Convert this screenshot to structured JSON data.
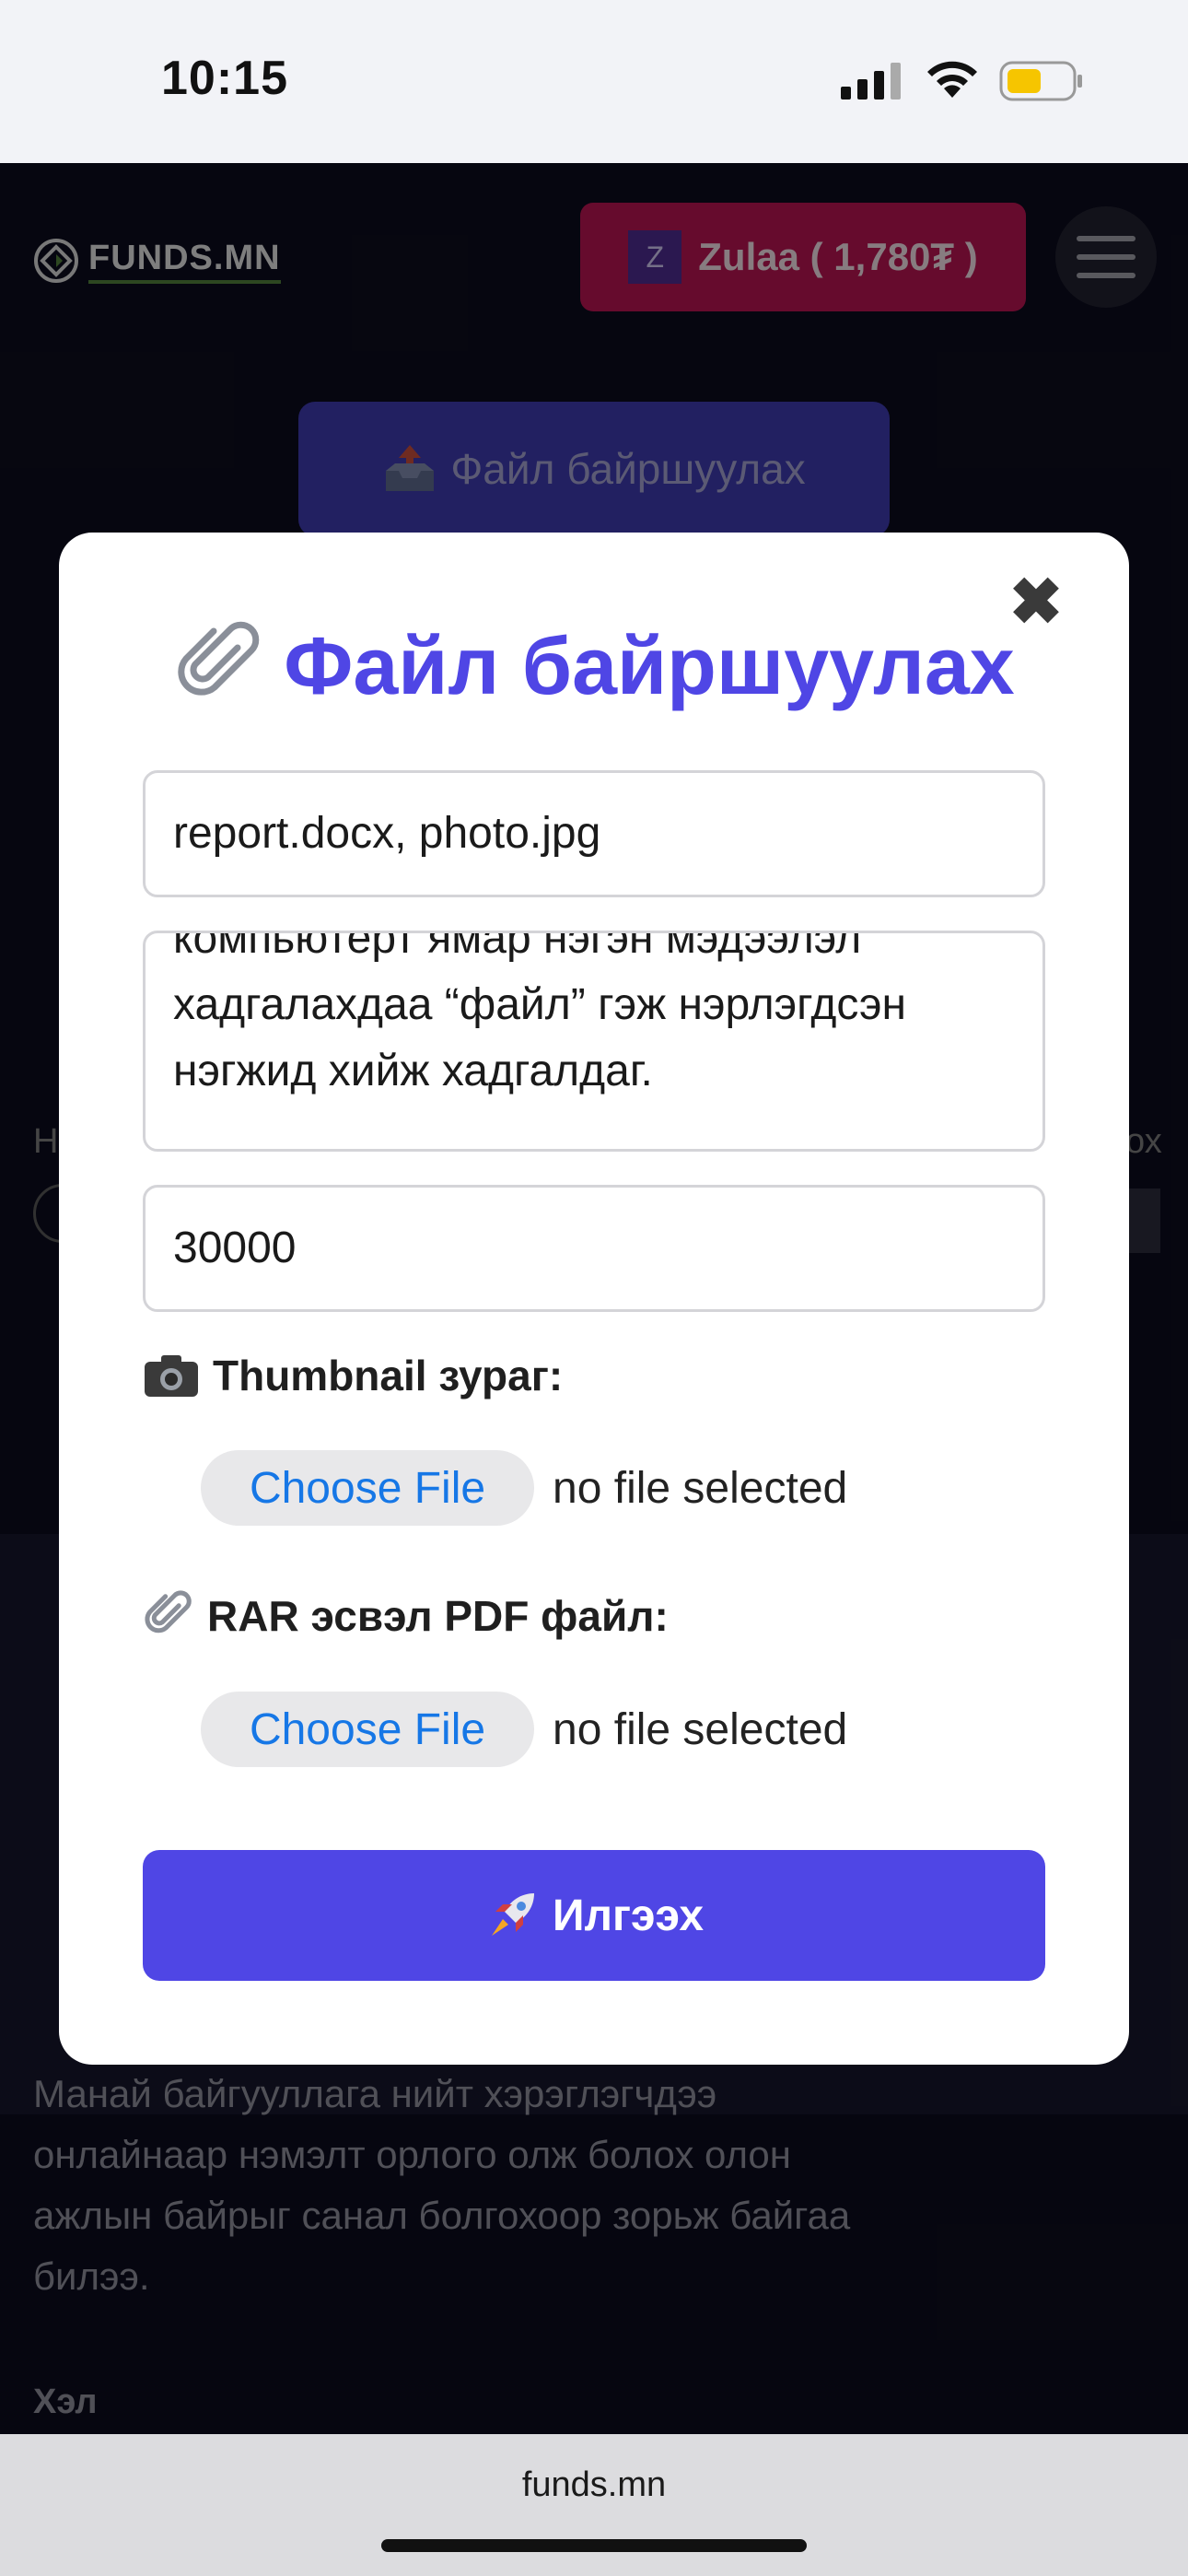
{
  "status_bar": {
    "time": "10:15"
  },
  "header": {
    "logo_text": "FUNDS.MN",
    "user_initial": "Z",
    "user_label": "Zulaa ( 1,780₮ )"
  },
  "background": {
    "upload_button_label": "Файл байршуулах",
    "left_peek": "Н",
    "right_peek": "ох",
    "about_text": "Манай байгууллага нийт хэрэглэгчдээ онлайнаар нэмэлт орлого олж болох олон ажлын байрыг санал болгохоор зорьж байгаа билээ.",
    "language_label": "Хэл"
  },
  "modal": {
    "title": "Файл байршуулах",
    "close_symbol": "✖",
    "name_field_value": "report.docx, photo.jpg",
    "description_value": "компьютерт ямар нэгэн мэдээлэл хадгалахдаа “файл” гэж нэрлэгдсэн нэгжид хийж хадгалдаг.",
    "price_field_value": "30000",
    "thumbnail_label": "Thumbnail зураг:",
    "thumbnail_choose": "Choose File",
    "thumbnail_status": "no file selected",
    "file_label": "RAR эсвэл PDF файл:",
    "file_choose": "Choose File",
    "file_status": "no file selected",
    "submit_label": "Илгээх"
  },
  "browser": {
    "url": "funds.mn"
  },
  "colors": {
    "accent": "#4f46e5",
    "user_pill": "#b0134f",
    "page_bg": "#0c0c1c"
  }
}
